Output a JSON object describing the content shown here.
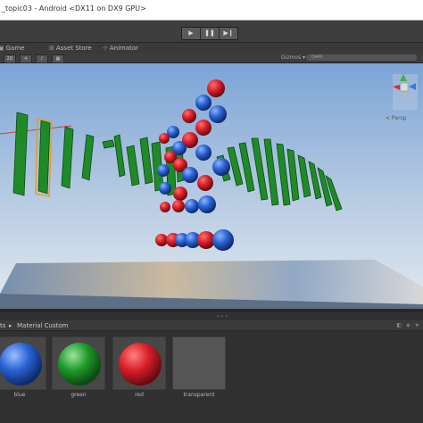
{
  "window": {
    "title": "_topic03 - Android <DX11 on DX9 GPU>"
  },
  "toolbar": {
    "play_icon": "▶",
    "pause_icon": "❚❚",
    "step_icon": "▶❙"
  },
  "tabs": [
    {
      "icon": "game-icon",
      "label": "Game"
    },
    {
      "icon": "asset-store-icon",
      "label": "Asset Store"
    },
    {
      "icon": "animator-icon",
      "label": "Animator"
    }
  ],
  "scene_toolbar": {
    "mode": "2D",
    "gizmos_label": "Gizmos ▾",
    "search_prefix": "Q▾All"
  },
  "scene": {
    "gizmo_label": "< Persp",
    "sky_top": "#7fa6d6",
    "sky_bottom": "#dfe7ef"
  },
  "project": {
    "breadcrumb_root": "ts",
    "breadcrumb_separator": "▸",
    "breadcrumb_folder": "Material Custom",
    "materials": [
      {
        "name": "blue",
        "color": "#2a62d4"
      },
      {
        "name": "green",
        "color": "#1f9a2a"
      },
      {
        "name": "red",
        "color": "#d8202a"
      },
      {
        "name": "transparent",
        "color": "#505050"
      }
    ]
  }
}
